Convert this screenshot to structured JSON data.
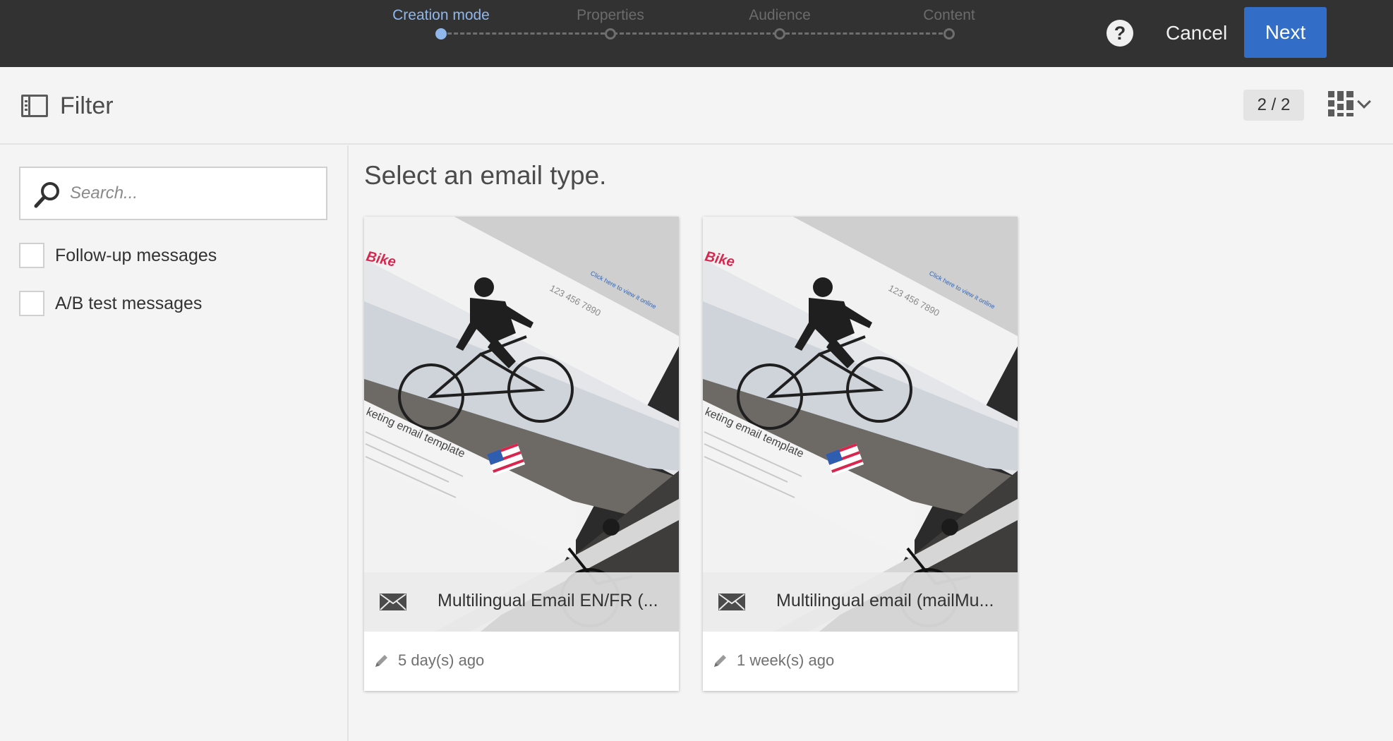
{
  "stepper": {
    "steps": [
      {
        "label": "Creation mode",
        "active": true
      },
      {
        "label": "Properties",
        "active": false
      },
      {
        "label": "Audience",
        "active": false
      },
      {
        "label": "Content",
        "active": false
      }
    ]
  },
  "header": {
    "help_glyph": "?",
    "cancel_label": "Cancel",
    "next_label": "Next"
  },
  "toolbar": {
    "filter_label": "Filter",
    "count": "2 / 2",
    "view_icon": "grid-view-icon"
  },
  "sidebar": {
    "search_placeholder": "Search...",
    "search_value": "",
    "options": [
      {
        "label": "Follow-up messages",
        "checked": false
      },
      {
        "label": "A/B test messages",
        "checked": false
      }
    ]
  },
  "main": {
    "title": "Select an email type.",
    "cards": [
      {
        "name": "Multilingual Email EN/FR (...",
        "modified": "5 day(s) ago",
        "icon": "envelope-icon"
      },
      {
        "name": "Multilingual email (mailMu...",
        "modified": "1 week(s) ago",
        "icon": "envelope-icon"
      }
    ]
  },
  "thumbnail": {
    "brand": "Bike",
    "phone": "123 456 7890",
    "template_caption": "keting email template",
    "link_text": "Click here to view it online"
  },
  "colors": {
    "topbar_bg": "#323232",
    "accent": "#326ec8",
    "active_step": "#8fb7ec",
    "brand_red": "#d9264e"
  }
}
